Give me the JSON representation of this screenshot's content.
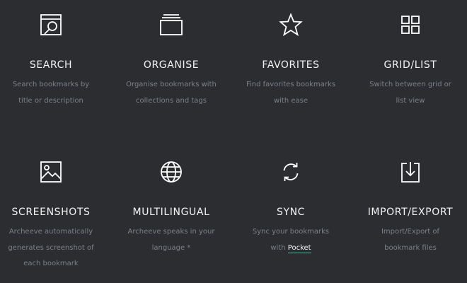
{
  "features": [
    {
      "icon": "search-screen-icon",
      "title": "SEARCH",
      "desc_lines": [
        "Search bookmarks by",
        "title or description"
      ]
    },
    {
      "icon": "stack-icon",
      "title": "ORGANISE",
      "desc_lines": [
        "Organise bookmarks with",
        "collections and tags"
      ]
    },
    {
      "icon": "star-icon",
      "title": "FAVORITES",
      "desc_lines": [
        "Find favorites bookmarks",
        "with ease"
      ]
    },
    {
      "icon": "grid-icon",
      "title": "GRID/LIST",
      "desc_lines": [
        "Switch between grid or",
        "list view"
      ]
    },
    {
      "icon": "image-icon",
      "title": "SCREENSHOTS",
      "desc_lines": [
        "Archeeve automatically",
        "generates screenshot of",
        "each bookmark"
      ]
    },
    {
      "icon": "globe-icon",
      "title": "MULTILINGUAL",
      "desc_lines": [
        "Archeeve speaks in your",
        "language *"
      ]
    },
    {
      "icon": "sync-icon",
      "title": "SYNC",
      "desc_lines": [
        "Sync your bookmarks"
      ],
      "desc_line2_prefix": "with",
      "link_label": "Pocket"
    },
    {
      "icon": "download-icon",
      "title": "IMPORT/EXPORT",
      "desc_lines": [
        "Import/Export of",
        "bookmark files"
      ]
    }
  ],
  "colors": {
    "background": "#2b2d31",
    "title": "#f3f3f3",
    "description": "#7c8088",
    "link_underline": "#3dbb9c"
  }
}
